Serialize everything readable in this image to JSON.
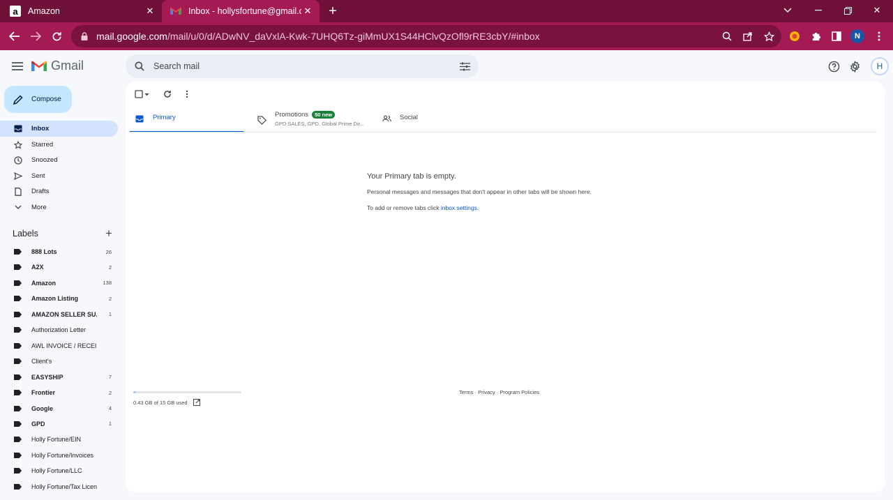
{
  "browser": {
    "tabs": [
      {
        "title": "Amazon",
        "active": false
      },
      {
        "title": "Inbox - hollysfortune@gmail.com",
        "active": true
      }
    ],
    "url_host": "mail.google.com",
    "url_path": "/mail/u/0/d/ADwNV_daVxlA-Kwk-7UHQ6Tz-giMmUX1S44HClvQzOfl9rRE3cbY/#inbox",
    "profile_initial": "N",
    "theme_color": "#a41a55"
  },
  "gmail": {
    "logo_text": "Gmail",
    "search_placeholder": "Search mail",
    "account_initial": "H",
    "compose_label": "Compose",
    "nav": [
      {
        "label": "Inbox",
        "icon": "inbox-icon",
        "active": true
      },
      {
        "label": "Starred",
        "icon": "star-icon"
      },
      {
        "label": "Snoozed",
        "icon": "clock-icon"
      },
      {
        "label": "Sent",
        "icon": "send-icon"
      },
      {
        "label": "Drafts",
        "icon": "draft-icon"
      },
      {
        "label": "More",
        "icon": "chevron-down-icon"
      }
    ],
    "labels_heading": "Labels",
    "labels": [
      {
        "name": "888 Lots",
        "count": "26",
        "bold": true
      },
      {
        "name": "A2X",
        "count": "2",
        "bold": true
      },
      {
        "name": "Amazon",
        "count": "138",
        "bold": true
      },
      {
        "name": "Amazon Listing",
        "count": "2",
        "bold": true
      },
      {
        "name": "AMAZON SELLER SU...",
        "count": "1",
        "bold": true
      },
      {
        "name": "Authorization Letter",
        "count": "",
        "bold": false
      },
      {
        "name": "AWL INVOICE / RECEIPT",
        "count": "",
        "bold": false
      },
      {
        "name": "Client's",
        "count": "",
        "bold": false
      },
      {
        "name": "EASYSHIP",
        "count": "7",
        "bold": true
      },
      {
        "name": "Frontier",
        "count": "2",
        "bold": true
      },
      {
        "name": "Google",
        "count": "4",
        "bold": true
      },
      {
        "name": "GPD",
        "count": "1",
        "bold": true
      },
      {
        "name": "Holly Fortune/EIN",
        "count": "",
        "bold": false
      },
      {
        "name": "Holly Fortune/Invoices",
        "count": "",
        "bold": false
      },
      {
        "name": "Holly Fortune/LLC",
        "count": "",
        "bold": false
      },
      {
        "name": "Holly Fortune/Tax License",
        "count": "",
        "bold": false
      }
    ],
    "tabs": {
      "primary": "Primary",
      "promotions": "Promotions",
      "promotions_badge": "50 new",
      "promotions_senders": "GPD SALES, GPD, Global Prime Dir...",
      "social": "Social"
    },
    "empty": {
      "title": "Your Primary tab is empty.",
      "line1": "Personal messages and messages that don't appear in other tabs will be shown here.",
      "line2_prefix": "To add or remove tabs click",
      "line2_link": "inbox settings",
      "line2_suffix": "."
    },
    "storage": {
      "text": "0.43 GB of 15 GB used",
      "fraction_used": 0.029
    },
    "footer": "Terms · Privacy · Program Policies"
  }
}
